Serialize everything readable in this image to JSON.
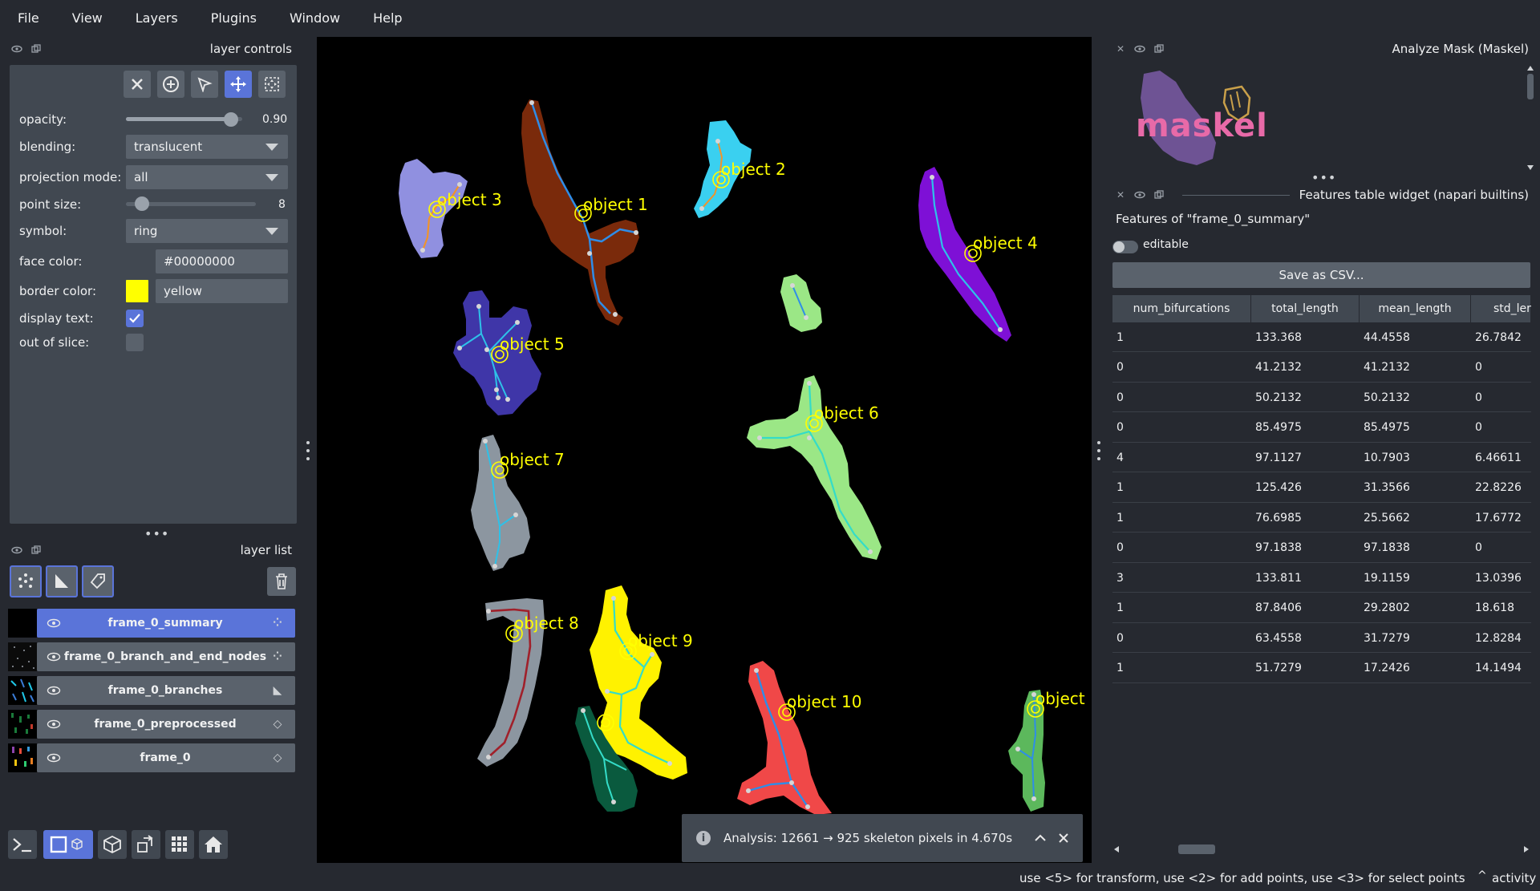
{
  "menu": [
    "File",
    "View",
    "Layers",
    "Plugins",
    "Window",
    "Help"
  ],
  "layer_controls": {
    "title": "layer controls",
    "opacity_label": "opacity:",
    "opacity_value": "0.90",
    "opacity": 0.9,
    "blending_label": "blending:",
    "blending_value": "translucent",
    "projection_label": "projection mode:",
    "projection_value": "all",
    "point_size_label": "point size:",
    "point_size_value": "8",
    "symbol_label": "symbol:",
    "symbol_value": "ring",
    "face_color_label": "face color:",
    "face_color_value": "#00000000",
    "border_color_label": "border color:",
    "border_color_value": "yellow",
    "border_color_swatch": "#ffff00",
    "display_text_label": "display text:",
    "display_text_checked": true,
    "out_of_slice_label": "out of slice:",
    "out_of_slice_checked": false
  },
  "layer_list": {
    "title": "layer list",
    "layers": [
      {
        "name": "frame_0_summary",
        "type_icon": "points-icon",
        "selected": true
      },
      {
        "name": "frame_0_branch_and_end_nodes",
        "type_icon": "points-icon",
        "selected": false
      },
      {
        "name": "frame_0_branches",
        "type_icon": "shapes-icon",
        "selected": false
      },
      {
        "name": "frame_0_preprocessed",
        "type_icon": "labels-icon",
        "selected": false
      },
      {
        "name": "frame_0",
        "type_icon": "labels-icon",
        "selected": false
      }
    ]
  },
  "canvas": {
    "objects": [
      "object 1",
      "object 2",
      "object 3",
      "object 4",
      "object 5",
      "object 6",
      "object 7",
      "object 8",
      "object 9",
      "object 10",
      "object"
    ]
  },
  "notification": {
    "text": "Analysis: 12661 → 925 skeleton pixels in 4.670s"
  },
  "analyze_mask": {
    "title": "Analyze Mask (Maskel)",
    "logo_text": "maskel"
  },
  "features": {
    "title": "Features table widget (napari builtins)",
    "subtitle": "Features of \"frame_0_summary\"",
    "editable_label": "editable",
    "save_label": "Save as CSV...",
    "columns": [
      "num_bifurcations",
      "total_length",
      "mean_length",
      "std_ler"
    ],
    "rows": [
      [
        "1",
        "133.368",
        "44.4558",
        "26.7842"
      ],
      [
        "0",
        "41.2132",
        "41.2132",
        "0"
      ],
      [
        "0",
        "50.2132",
        "50.2132",
        "0"
      ],
      [
        "0",
        "85.4975",
        "85.4975",
        "0"
      ],
      [
        "4",
        "97.1127",
        "10.7903",
        "6.46611"
      ],
      [
        "1",
        "125.426",
        "31.3566",
        "22.8226"
      ],
      [
        "1",
        "76.6985",
        "25.5662",
        "17.6772"
      ],
      [
        "0",
        "97.1838",
        "97.1838",
        "0"
      ],
      [
        "3",
        "133.811",
        "19.1159",
        "13.0396"
      ],
      [
        "1",
        "87.8406",
        "29.2802",
        "18.618"
      ],
      [
        "0",
        "63.4558",
        "31.7279",
        "12.8284"
      ],
      [
        "1",
        "51.7279",
        "17.2426",
        "14.1494"
      ]
    ]
  },
  "status": {
    "hint": "use <5> for transform, use <2> for add points, use <3> for select points",
    "activity": "activity"
  }
}
